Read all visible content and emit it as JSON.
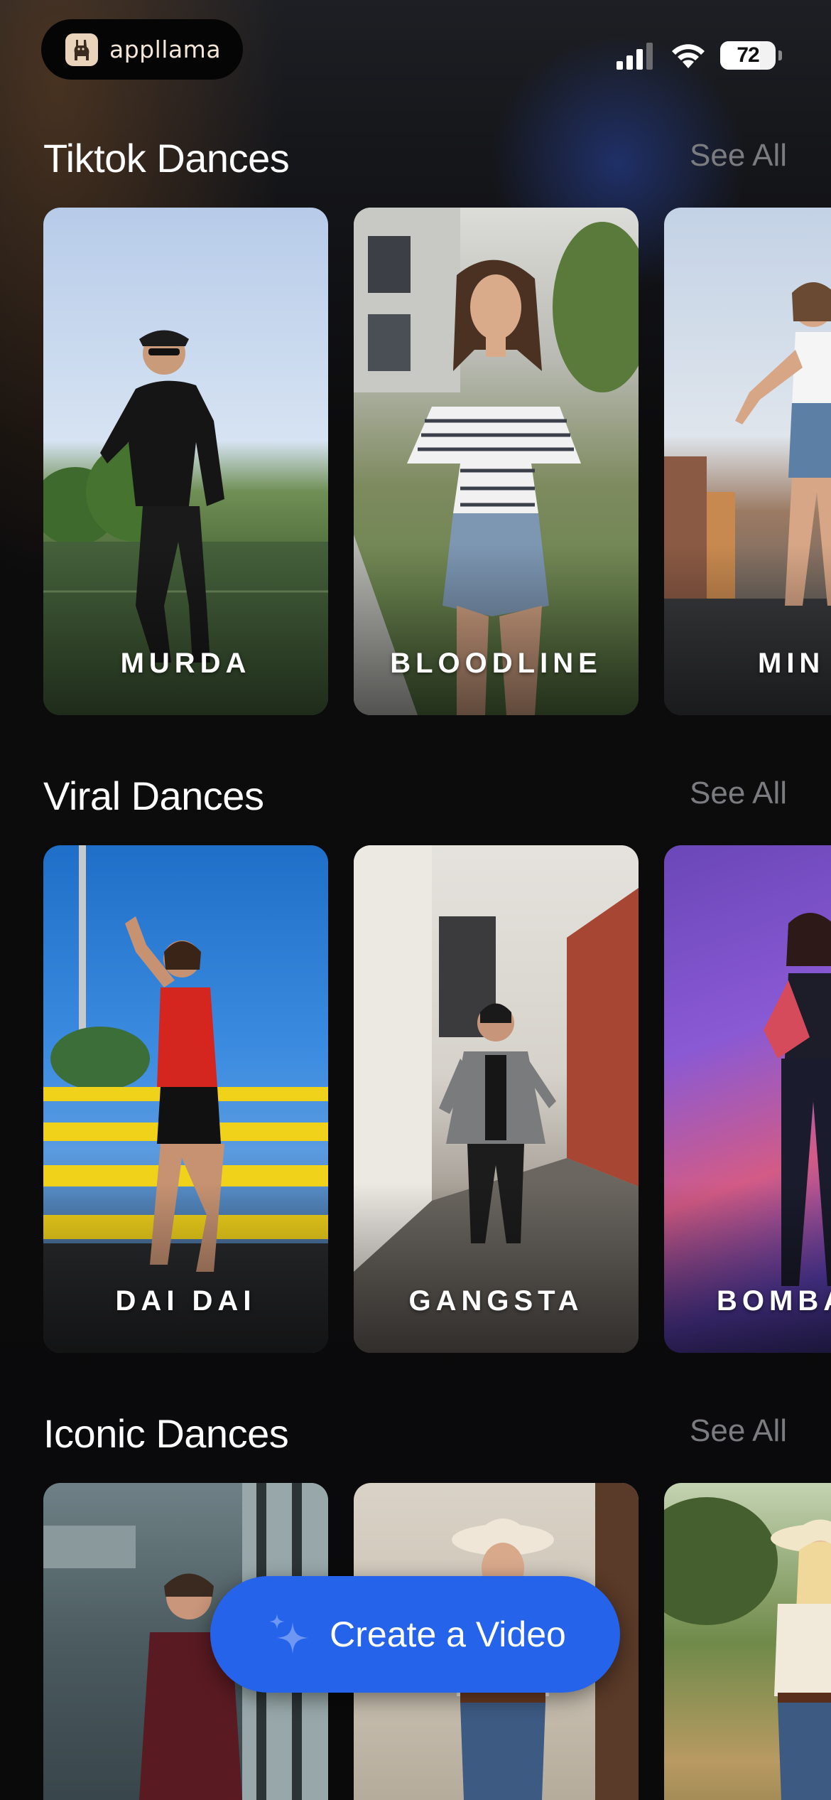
{
  "status_bar": {
    "brand_name": "appllama",
    "battery_text": "72",
    "battery_level_percent": 72
  },
  "sections": [
    {
      "title": "Tiktok Dances",
      "see_all_label": "See All",
      "cards": [
        {
          "label": "MURDA"
        },
        {
          "label": "BLOODLINE"
        },
        {
          "label": "MIN"
        }
      ]
    },
    {
      "title": "Viral Dances",
      "see_all_label": "See All",
      "cards": [
        {
          "label": "DAI DAI"
        },
        {
          "label": "GANGSTA"
        },
        {
          "label": "BOMBA"
        }
      ]
    },
    {
      "title": "Iconic Dances",
      "see_all_label": "See All",
      "cards": [
        {
          "label": ""
        },
        {
          "label": ""
        },
        {
          "label": ""
        }
      ]
    }
  ],
  "create_button": {
    "label": "Create a Video",
    "icon": "sparkles-icon",
    "color": "#2563eb"
  }
}
